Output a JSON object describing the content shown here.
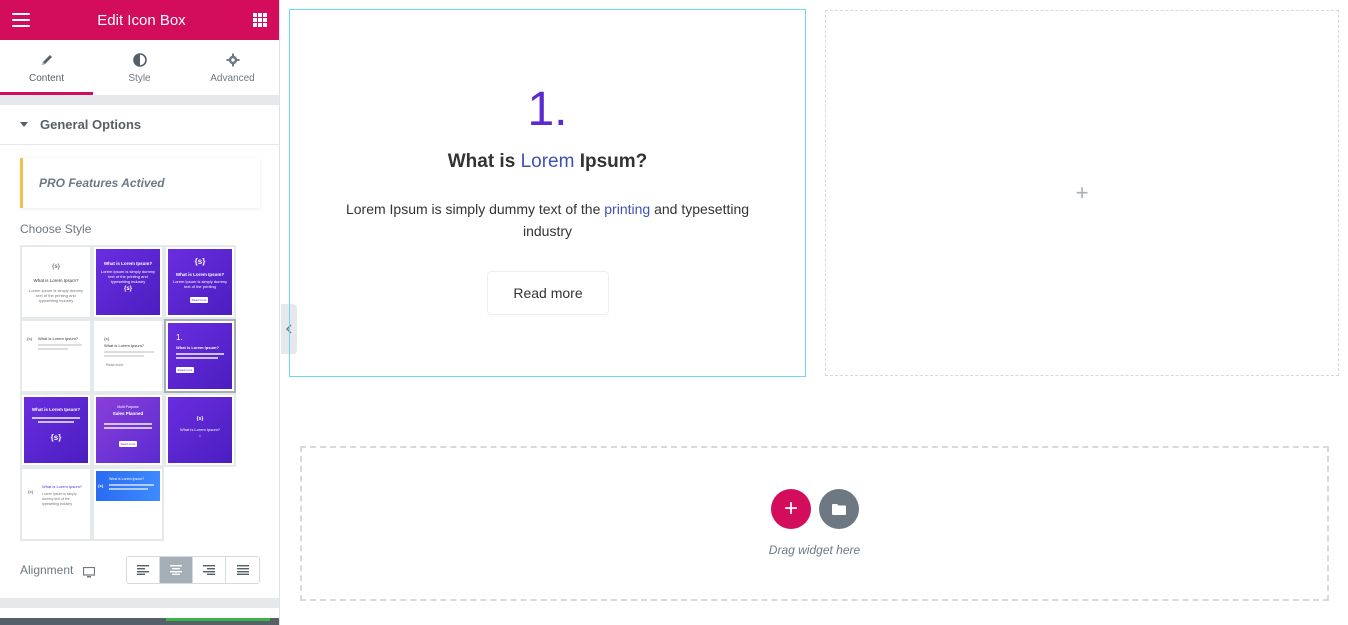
{
  "panel": {
    "title": "Edit Icon Box",
    "tabs": [
      {
        "label": "Content",
        "icon": "pencil-icon",
        "active": true
      },
      {
        "label": "Style",
        "icon": "half-circle-icon",
        "active": false
      },
      {
        "label": "Advanced",
        "icon": "gear-icon",
        "active": false
      }
    ],
    "section_title": "General Options",
    "pro_notice": "PRO Features Actived",
    "choose_style_label": "Choose Style",
    "styles": {
      "s1": {
        "number": "{s}",
        "title": "What is Lorem Ipsum?",
        "text": "Lorem Ipsum is simply dummy text of the printing and typesetting industry"
      },
      "s2": {
        "title": "What is Lorem Ipsum?",
        "text": "Lorem Ipsum is simply dummy text of the printing and typesetting industry",
        "icon": "{s}"
      },
      "s3": {
        "icon": "{s}",
        "title": "What is Lorem Ipsum?",
        "text": "Lorem Ipsum is simply dummy text of the printing",
        "button": "Read more"
      },
      "s4": {
        "icon": "{s}",
        "title": "What is Lorem Ipsum?"
      },
      "s5": {
        "icon": "{s}",
        "title": "What is Lorem Ipsum?",
        "button": "Read more"
      },
      "s6": {
        "number": "1.",
        "title": "What is Lorem Ipsum?",
        "button": "Read more"
      },
      "s7": {
        "title": "What is Lorem Ipsum?",
        "icon": "{s}"
      },
      "s8": {
        "subtitle": "Multi Purpose",
        "title": "Sales Planned",
        "button": "Read more"
      },
      "s9": {
        "icon": "{s}",
        "title": "What is Lorem Ipsum?"
      },
      "s10": {
        "icon": "{s}",
        "title": "What is Lorem Ipsum?",
        "text": "Lorem Ipsum is simply dummy text of the typesetting industry"
      },
      "s11": {
        "icon": "{s}",
        "title": "What is Lorem Ipsum?"
      }
    },
    "alignment_label": "Alignment",
    "alignment_options": [
      "left",
      "center",
      "right",
      "justify"
    ],
    "alignment_selected": "center"
  },
  "widget": {
    "number": "1.",
    "title_pre": "What is ",
    "title_hl": "Lorem",
    "title_post": " Ipsum?",
    "desc_pre": "Lorem Ipsum is simply dummy text of the ",
    "desc_hl": "printing",
    "desc_post": " and typesetting industry",
    "button": "Read more"
  },
  "empty_column": {
    "plus": "+"
  },
  "drop_zone": {
    "add": "+",
    "text": "Drag widget here"
  },
  "colors": {
    "brand": "#d30c5c",
    "accent": "#5a2bd2",
    "link": "#3f51b5"
  }
}
